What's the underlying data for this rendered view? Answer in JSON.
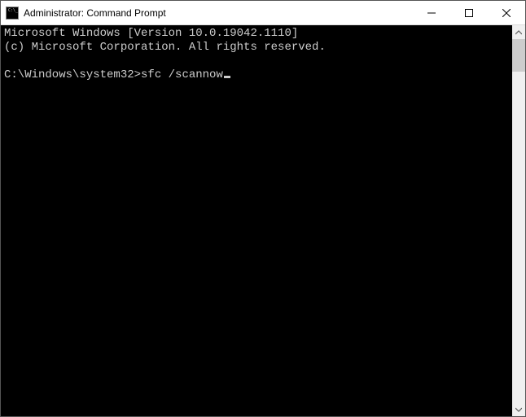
{
  "window": {
    "title": "Administrator: Command Prompt"
  },
  "terminal": {
    "line1": "Microsoft Windows [Version 10.0.19042.1110]",
    "line2": "(c) Microsoft Corporation. All rights reserved.",
    "prompt": "C:\\Windows\\system32>",
    "command": "sfc /scannow"
  }
}
